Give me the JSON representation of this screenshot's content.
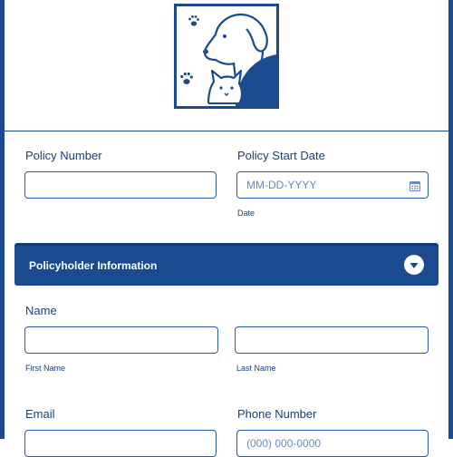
{
  "form": {
    "policy_number": {
      "label": "Policy Number",
      "value": ""
    },
    "policy_start_date": {
      "label": "Policy Start Date",
      "placeholder": "MM-DD-YYYY",
      "sublabel": "Date",
      "value": ""
    }
  },
  "section": {
    "title": "Policyholder Information"
  },
  "name": {
    "label": "Name",
    "first_sublabel": "First Name",
    "last_sublabel": "Last Name",
    "first_value": "",
    "last_value": ""
  },
  "email": {
    "label": "Email",
    "value": ""
  },
  "phone": {
    "label": "Phone Number",
    "placeholder": "(000) 000-0000",
    "value": ""
  },
  "icons": {
    "logo": "pet-insurance-logo",
    "calendar": "calendar-icon",
    "toggle": "chevron-down-icon"
  },
  "colors": {
    "primary": "#1c4a8f",
    "text": "#1b3f7a",
    "placeholder": "#6b8bbd"
  }
}
